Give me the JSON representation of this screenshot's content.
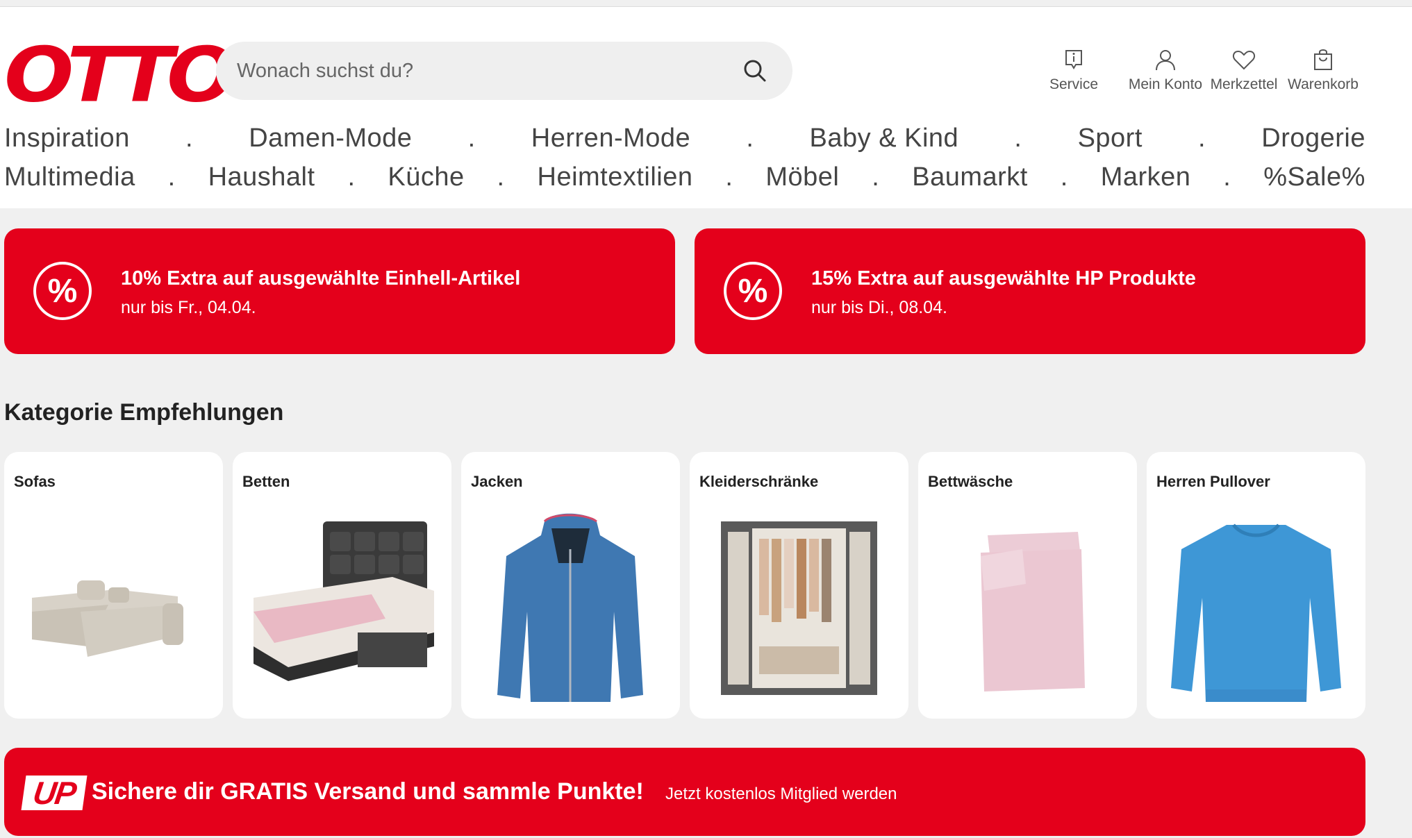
{
  "brand": {
    "logo": "OTTO",
    "accent": "#e4001b"
  },
  "search": {
    "placeholder": "Wonach suchst du?"
  },
  "header_actions": [
    {
      "label": "Service",
      "icon": "info-icon"
    },
    {
      "label": "Mein Konto",
      "icon": "user-icon"
    },
    {
      "label": "Merkzettel",
      "icon": "heart-icon"
    },
    {
      "label": "Warenkorb",
      "icon": "shopping-bag-icon"
    }
  ],
  "nav": {
    "row1": [
      "Inspiration",
      "Damen-Mode",
      "Herren-Mode",
      "Baby & Kind",
      "Sport",
      "Drogerie"
    ],
    "row2": [
      "Multimedia",
      "Haushalt",
      "Küche",
      "Heimtextilien",
      "Möbel",
      "Baumarkt",
      "Marken",
      "%Sale%"
    ],
    "separator": "."
  },
  "promos": [
    {
      "title": "10% Extra auf ausgewählte Einhell-Artikel",
      "subtitle": "nur bis Fr., 04.04.",
      "icon": "percent-icon",
      "symbol": "%"
    },
    {
      "title": "15% Extra auf ausgewählte HP Produkte",
      "subtitle": "nur bis Di., 08.04.",
      "icon": "percent-icon",
      "symbol": "%"
    }
  ],
  "categories": {
    "title": "Kategorie Empfehlungen",
    "items": [
      "Sofas",
      "Betten",
      "Jacken",
      "Kleiderschränke",
      "Bettwäsche",
      "Herren Pullover"
    ]
  },
  "up_banner": {
    "badge": "UP",
    "title": "Sichere dir GRATIS Versand und sammle Punkte!",
    "subtitle": "Jetzt kostenlos Mitglied werden"
  }
}
